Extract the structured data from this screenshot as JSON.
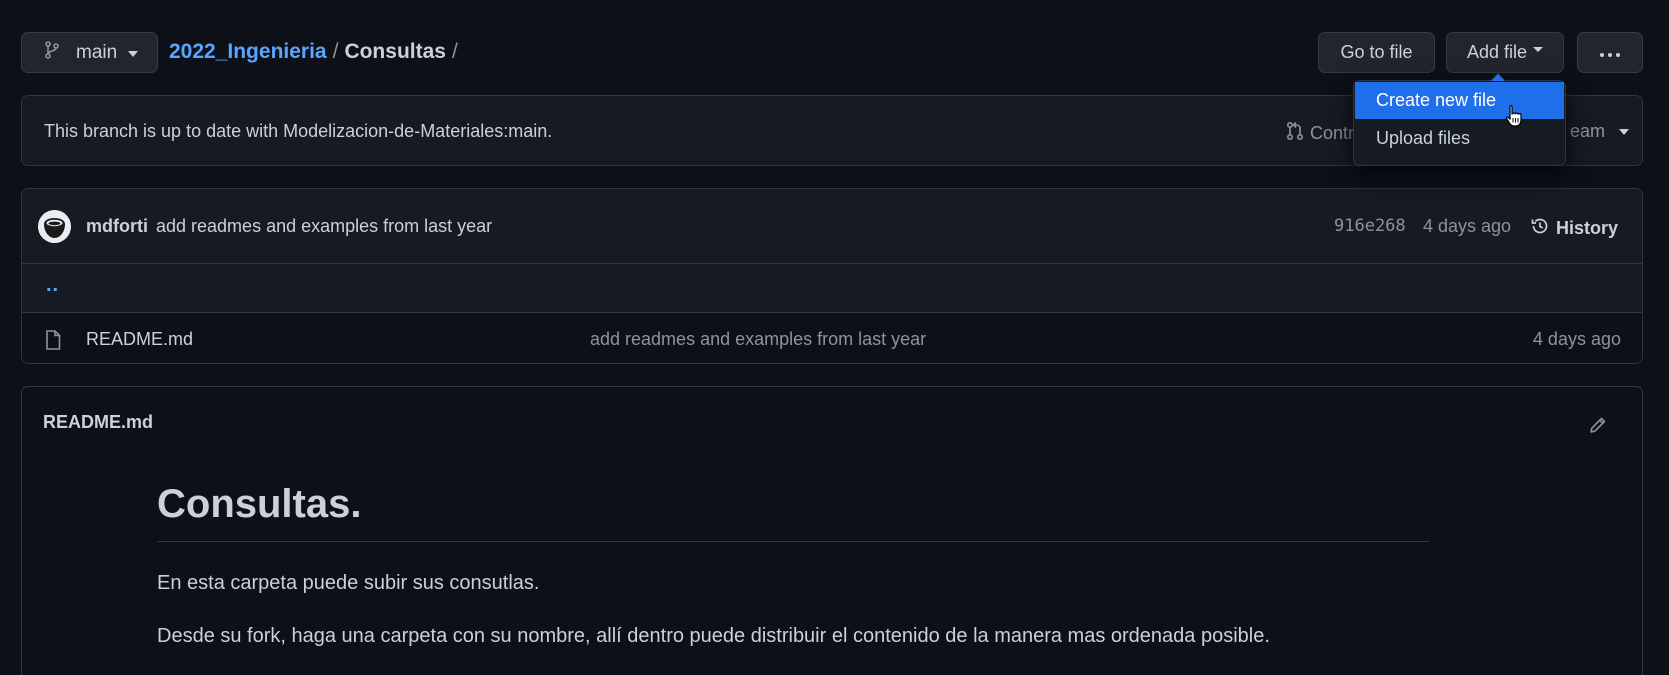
{
  "branch": {
    "name": "main"
  },
  "breadcrumb": {
    "repo": "2022_Ingenieria",
    "separator": "/",
    "current": "Consultas"
  },
  "toolbar": {
    "goto_label": "Go to file",
    "add_label": "Add file",
    "more_label": "···"
  },
  "add_menu": {
    "items": [
      "Create new file",
      "Upload files"
    ],
    "highlighted": "Create new file"
  },
  "branch_status": {
    "message": "This branch is up to date with Modelizacion-de-Materiales:main.",
    "contribute_label": "Contri",
    "fetch_label": "eam"
  },
  "commit": {
    "author": "mdforti",
    "message": "add readmes and examples from last year",
    "sha": "916e268",
    "time": "4 days ago",
    "history_label": "History"
  },
  "files": {
    "parent_link": "..",
    "rows": [
      {
        "name": "README.md",
        "message": "add readmes and examples from last year",
        "time": "4 days ago"
      }
    ]
  },
  "readme": {
    "filename": "README.md",
    "heading": "Consultas.",
    "paragraphs": [
      "En esta carpeta puede subir sus consutlas.",
      "Desde su fork, haga una carpeta con su nombre, allí dentro puede distribuir el contenido de la manera mas ordenada posible."
    ]
  },
  "colors": {
    "background": "#0d1117",
    "panel": "#161b22",
    "border": "#30363d",
    "link": "#58a6ff",
    "accent": "#1f6feb",
    "muted": "#8b949e",
    "text": "#c9d1d9"
  },
  "icons": [
    "git-branch-icon",
    "kebab-horizontal-icon",
    "git-pull-request-icon",
    "history-icon",
    "file-icon",
    "pencil-icon",
    "pointer-cursor-icon"
  ]
}
